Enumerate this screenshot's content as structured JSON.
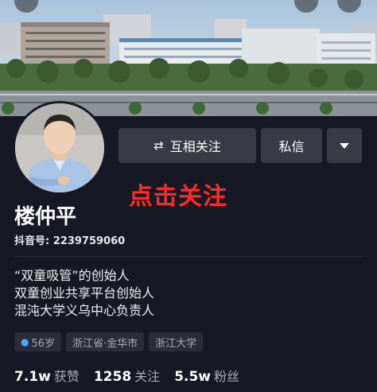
{
  "actions": {
    "follow_icon": "⇄",
    "follow_label": "互相关注",
    "message_label": "私信"
  },
  "overlay": {
    "text": "点击关注"
  },
  "profile": {
    "name": "楼仲平",
    "douyin_id": "抖音号: 2239759060",
    "bio": [
      "“双童吸管”的创始人",
      "双童创业共享平台创始人",
      "混沌大学义乌中心负责人"
    ],
    "tags": {
      "age": "56岁",
      "location": "浙江省·金华市",
      "school": "浙江大学"
    }
  },
  "stats": [
    {
      "num": "7.1w",
      "label": "获赞"
    },
    {
      "num": "1258",
      "label": "关注"
    },
    {
      "num": "5.5w",
      "label": "粉丝"
    }
  ],
  "colors": {
    "background": "#161823",
    "button": "#393b44",
    "overlay_red": "#ff2a2a",
    "tag_icon": "#4fa8ff"
  },
  "icons": [
    "mutual-follow-icon",
    "dropdown-caret-icon",
    "person-icon"
  ]
}
